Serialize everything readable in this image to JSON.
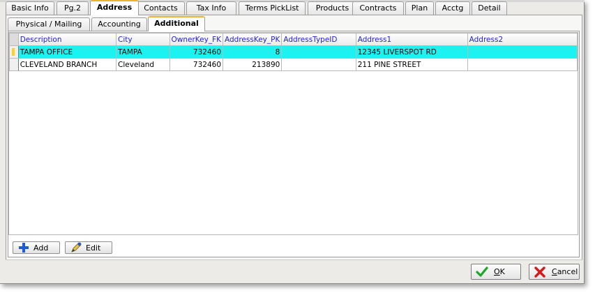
{
  "top_tabs": [
    {
      "label": "Basic Info"
    },
    {
      "label": "Pg.2"
    },
    {
      "label": "Address"
    },
    {
      "label": "Contacts"
    },
    {
      "label": "Tax Info"
    },
    {
      "label": "Terms PickList"
    },
    {
      "label": "Products"
    },
    {
      "label": "Contracts"
    },
    {
      "label": "Plan"
    },
    {
      "label": "Acctg"
    },
    {
      "label": "Detail"
    }
  ],
  "sub_tabs": [
    {
      "label": "Physical / Mailing"
    },
    {
      "label": "Accounting"
    },
    {
      "label": "Additional"
    }
  ],
  "grid": {
    "columns": [
      "Description",
      "City",
      "OwnerKey_FK",
      "AddressKey_PK",
      "AddressTypeID",
      "Address1",
      "Address2"
    ],
    "rows": [
      [
        "TAMPA OFFICE",
        "TAMPA",
        "732460",
        "8",
        "",
        "12345 LIVERSPOT RD",
        ""
      ],
      [
        "CLEVELAND BRANCH",
        "Cleveland",
        "732460",
        "213890",
        "",
        "211 PINE STREET",
        ""
      ]
    ]
  },
  "buttons": {
    "add": "Add",
    "edit": "Edit",
    "ok": "OK",
    "cancel": "Cancel"
  },
  "colors": {
    "selected_row": "#1cf2f2",
    "header_text": "#1f1fe0",
    "active_tab_accent": "#f0b030"
  },
  "icons": {
    "add": "plus-icon",
    "edit": "pen-icon",
    "ok": "checkmark-icon",
    "cancel": "x-icon"
  }
}
